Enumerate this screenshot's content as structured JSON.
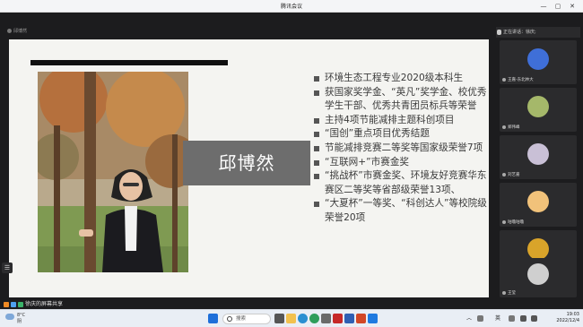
{
  "window": {
    "title": "腾讯会议",
    "minimize": "—",
    "maximize": "▢",
    "close": "✕"
  },
  "share": {
    "label": "邱博然"
  },
  "slide": {
    "name": "邱博然",
    "achievements": [
      "环境生态工程专业2020级本科生",
      "获国家奖学金、“英凡”奖学金、校优秀学生干部、优秀共青团员标兵等荣誉",
      "主持4项节能减排主题科创项目",
      "“国创”重点项目优秀结题",
      "节能减排竞赛二等奖等国家级荣誉7项",
      "“互联网+”市赛金奖",
      "“挑战杯”市赛金奖、环境友好竞赛华东赛区二等奖等省部级荣誉13项、",
      "“大夏杯”一等奖、“科创达人”等校院级荣誉20项"
    ]
  },
  "panel": {
    "speaking": "正在讲话：徐庆;",
    "participants": [
      {
        "name": "王嘉-东北林大",
        "color": "#3f6fd8"
      },
      {
        "name": "郑伟峰",
        "color": "#a5b86a"
      },
      {
        "name": "刘艺嘉",
        "color": "#c9c0d6"
      },
      {
        "name": "咕噜咕噜",
        "color": "#f1c27a"
      },
      {
        "name": "陈晓",
        "color": "#d9a42a"
      },
      {
        "name": "王莹",
        "color": "#cfcfcf"
      }
    ]
  },
  "status": {
    "text": "徐庆的屏幕共享"
  },
  "taskbar": {
    "weather_temp": "8°C",
    "weather_desc": "阴",
    "search": "搜索",
    "lang": "英",
    "time": "19:03",
    "date": "2022/12/4",
    "chevron": "︿"
  },
  "colors": {
    "slide_bg": "#f4f4f1",
    "namebox": "#6d6d6d",
    "panel_bg": "#1c1c1e"
  }
}
